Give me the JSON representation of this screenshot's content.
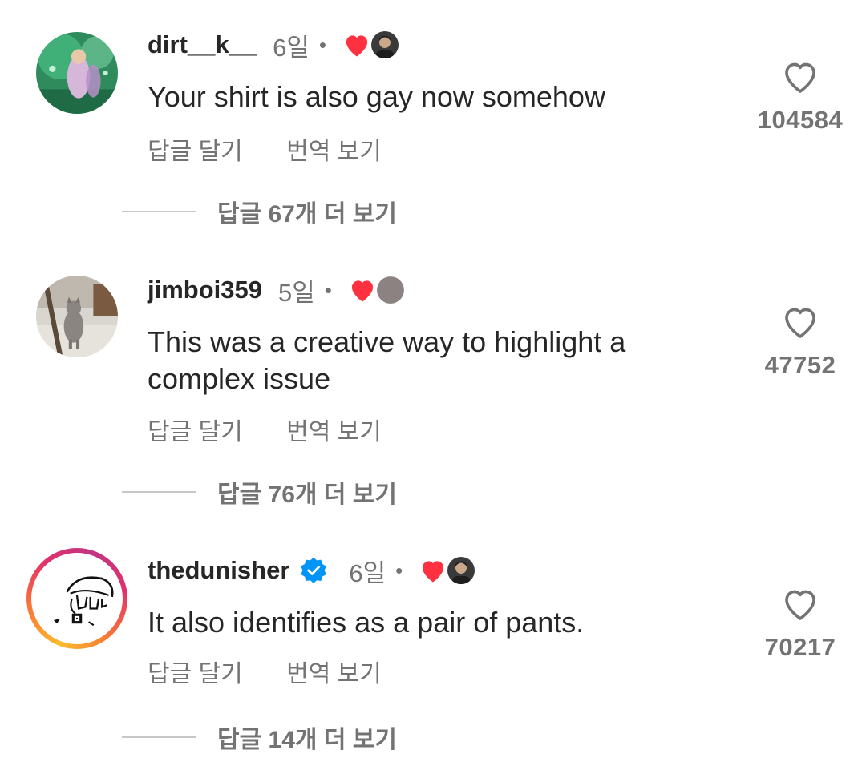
{
  "comments": [
    {
      "username": "dirt__k__",
      "verified": false,
      "age": "6일",
      "separator": "•",
      "text": "Your shirt is also gay now somehow",
      "reply_label": "답글 달기",
      "translate_label": "번역 보기",
      "like_count": "104584",
      "more_replies": "답글 67개 더 보기",
      "avatar_icon": "concert-photo-avatar",
      "creator_liked": true
    },
    {
      "username": "jimboi359",
      "verified": false,
      "age": "5일",
      "separator": "•",
      "text": "This was a creative way to highlight a complex issue",
      "reply_label": "답글 달기",
      "translate_label": "번역 보기",
      "like_count": "47752",
      "more_replies": "답글 76개 더 보기",
      "avatar_icon": "cat-photo-avatar",
      "creator_liked": true
    },
    {
      "username": "thedunisher",
      "verified": true,
      "age": "6일",
      "separator": "•",
      "text": "It also identifies as a pair of pants.",
      "reply_label": "답글 달기",
      "translate_label": "번역 보기",
      "like_count": "70217",
      "more_replies": "답글 14개 더 보기",
      "avatar_icon": "sketch-logo-avatar",
      "creator_liked": true
    }
  ],
  "colors": {
    "heart_red": "#ff3040",
    "verified_blue": "#0095f6",
    "muted_text": "#737373",
    "primary_text": "#262626"
  }
}
